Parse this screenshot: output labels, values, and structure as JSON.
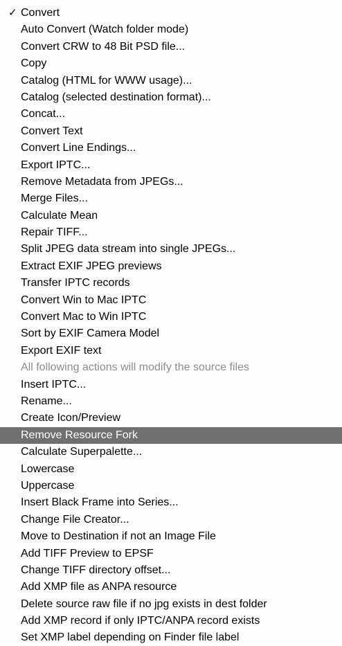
{
  "menu": {
    "checkmark_glyph": "✓",
    "highlight_color": "#707070",
    "items": [
      {
        "label": "Convert",
        "checked": true,
        "disabled": false,
        "highlighted": false
      },
      {
        "label": "Auto Convert (Watch folder mode)",
        "checked": false,
        "disabled": false,
        "highlighted": false
      },
      {
        "label": "Convert CRW to 48 Bit PSD file...",
        "checked": false,
        "disabled": false,
        "highlighted": false
      },
      {
        "label": "Copy",
        "checked": false,
        "disabled": false,
        "highlighted": false
      },
      {
        "label": "Catalog (HTML for WWW usage)...",
        "checked": false,
        "disabled": false,
        "highlighted": false
      },
      {
        "label": "Catalog (selected destination format)...",
        "checked": false,
        "disabled": false,
        "highlighted": false
      },
      {
        "label": "Concat...",
        "checked": false,
        "disabled": false,
        "highlighted": false
      },
      {
        "label": "Convert Text",
        "checked": false,
        "disabled": false,
        "highlighted": false
      },
      {
        "label": "Convert Line Endings...",
        "checked": false,
        "disabled": false,
        "highlighted": false
      },
      {
        "label": "Export IPTC...",
        "checked": false,
        "disabled": false,
        "highlighted": false
      },
      {
        "label": "Remove Metadata from JPEGs...",
        "checked": false,
        "disabled": false,
        "highlighted": false
      },
      {
        "label": "Merge Files...",
        "checked": false,
        "disabled": false,
        "highlighted": false
      },
      {
        "label": "Calculate Mean",
        "checked": false,
        "disabled": false,
        "highlighted": false
      },
      {
        "label": "Repair TIFF...",
        "checked": false,
        "disabled": false,
        "highlighted": false
      },
      {
        "label": "Split JPEG data stream into single JPEGs...",
        "checked": false,
        "disabled": false,
        "highlighted": false
      },
      {
        "label": "Extract EXIF JPEG previews",
        "checked": false,
        "disabled": false,
        "highlighted": false
      },
      {
        "label": "Transfer IPTC records",
        "checked": false,
        "disabled": false,
        "highlighted": false
      },
      {
        "label": "Convert Win to Mac IPTC",
        "checked": false,
        "disabled": false,
        "highlighted": false
      },
      {
        "label": "Convert Mac to Win IPTC",
        "checked": false,
        "disabled": false,
        "highlighted": false
      },
      {
        "label": "Sort by EXIF Camera Model",
        "checked": false,
        "disabled": false,
        "highlighted": false
      },
      {
        "label": "Export EXIF text",
        "checked": false,
        "disabled": false,
        "highlighted": false
      },
      {
        "label": "All following actions will modify the source files",
        "checked": false,
        "disabled": true,
        "highlighted": false
      },
      {
        "label": "Insert IPTC...",
        "checked": false,
        "disabled": false,
        "highlighted": false
      },
      {
        "label": "Rename...",
        "checked": false,
        "disabled": false,
        "highlighted": false
      },
      {
        "label": "Create Icon/Preview",
        "checked": false,
        "disabled": false,
        "highlighted": false
      },
      {
        "label": "Remove Resource Fork",
        "checked": false,
        "disabled": false,
        "highlighted": true
      },
      {
        "label": "Calculate Superpalette...",
        "checked": false,
        "disabled": false,
        "highlighted": false
      },
      {
        "label": "Lowercase",
        "checked": false,
        "disabled": false,
        "highlighted": false
      },
      {
        "label": "Uppercase",
        "checked": false,
        "disabled": false,
        "highlighted": false
      },
      {
        "label": "Insert Black Frame into Series...",
        "checked": false,
        "disabled": false,
        "highlighted": false
      },
      {
        "label": "Change File Creator...",
        "checked": false,
        "disabled": false,
        "highlighted": false
      },
      {
        "label": "Move to Destination if not an Image File",
        "checked": false,
        "disabled": false,
        "highlighted": false
      },
      {
        "label": "Add TIFF Preview to EPSF",
        "checked": false,
        "disabled": false,
        "highlighted": false
      },
      {
        "label": "Change TIFF directory offset...",
        "checked": false,
        "disabled": false,
        "highlighted": false
      },
      {
        "label": "Add XMP file as ANPA resource",
        "checked": false,
        "disabled": false,
        "highlighted": false
      },
      {
        "label": "Delete source raw file if no jpg exists in dest folder",
        "checked": false,
        "disabled": false,
        "highlighted": false
      },
      {
        "label": "Add XMP record if only IPTC/ANPA record exists",
        "checked": false,
        "disabled": false,
        "highlighted": false
      },
      {
        "label": "Set XMP label depending on Finder file label",
        "checked": false,
        "disabled": false,
        "highlighted": false
      }
    ]
  }
}
